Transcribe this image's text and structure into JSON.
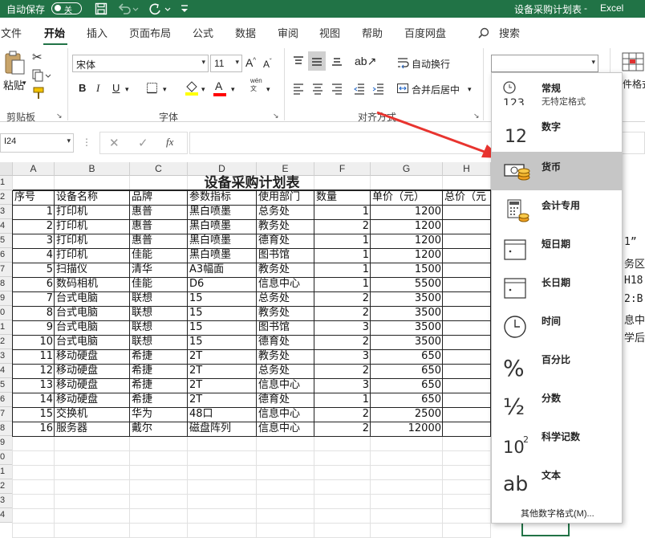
{
  "titlebar": {
    "autosave": "自动保存",
    "toggle": "关",
    "doc_title": "设备采购计划表",
    "app": "Excel"
  },
  "tabs": [
    "文件",
    "开始",
    "插入",
    "页面布局",
    "公式",
    "数据",
    "审阅",
    "视图",
    "帮助",
    "百度网盘"
  ],
  "search": "搜索",
  "ribbon": {
    "paste": "粘贴",
    "clipboard": "剪贴板",
    "font_name": "宋体",
    "font_size": "11",
    "font_group": "字体",
    "wrap": "自动换行",
    "merge": "合并后居中",
    "align_group": "对齐方式",
    "style_btn": "件格式"
  },
  "formula_bar": {
    "name_box": "I24",
    "fx": "fx"
  },
  "grid": {
    "columns": [
      "A",
      "B",
      "C",
      "D",
      "E",
      "F",
      "G",
      "H"
    ],
    "row_numbers": [
      "1",
      "2",
      "3",
      "4",
      "5",
      "6",
      "7",
      "8",
      "9",
      "0",
      "1",
      "2",
      "3",
      "4",
      "5",
      "6",
      "7",
      "8",
      "9",
      "0",
      "1",
      "2",
      "3",
      "4"
    ],
    "title": "设备采购计划表",
    "headers": [
      "序号",
      "设备名称",
      "品牌",
      "参数指标",
      "使用部门",
      "数量",
      "单价（元）",
      "总价（元"
    ],
    "rows": [
      [
        "1",
        "打印机",
        "惠普",
        "黑白喷墨",
        "总务处",
        "1",
        "1200"
      ],
      [
        "2",
        "打印机",
        "惠普",
        "黑白喷墨",
        "教务处",
        "2",
        "1200"
      ],
      [
        "3",
        "打印机",
        "惠普",
        "黑白喷墨",
        "德育处",
        "1",
        "1200"
      ],
      [
        "4",
        "打印机",
        "佳能",
        "黑白喷墨",
        "图书馆",
        "1",
        "1200"
      ],
      [
        "5",
        "扫描仪",
        "清华",
        "A3幅面",
        "教务处",
        "1",
        "1500"
      ],
      [
        "6",
        "数码相机",
        "佳能",
        "D6",
        "信息中心",
        "1",
        "5500"
      ],
      [
        "7",
        "台式电脑",
        "联想",
        "15",
        "总务处",
        "2",
        "3500"
      ],
      [
        "8",
        "台式电脑",
        "联想",
        "15",
        "教务处",
        "2",
        "3500"
      ],
      [
        "9",
        "台式电脑",
        "联想",
        "15",
        "图书馆",
        "3",
        "3500"
      ],
      [
        "10",
        "台式电脑",
        "联想",
        "15",
        "德育处",
        "2",
        "3500"
      ],
      [
        "11",
        "移动硬盘",
        "希捷",
        "2T",
        "教务处",
        "3",
        "650"
      ],
      [
        "12",
        "移动硬盘",
        "希捷",
        "2T",
        "总务处",
        "2",
        "650"
      ],
      [
        "13",
        "移动硬盘",
        "希捷",
        "2T",
        "信息中心",
        "3",
        "650"
      ],
      [
        "14",
        "移动硬盘",
        "希捷",
        "2T",
        "德育处",
        "1",
        "650"
      ],
      [
        "15",
        "交换机",
        "华为",
        "48口",
        "信息中心",
        "2",
        "2500"
      ],
      [
        "16",
        "服务器",
        "戴尔",
        "磁盘阵列",
        "信息中心",
        "2",
        "12000"
      ]
    ]
  },
  "side_text": [
    "1”",
    "务区:",
    "H18",
    "2:B",
    "息中/",
    "学后"
  ],
  "number_format": {
    "items": [
      {
        "label": "常规",
        "sub": "无特定格式",
        "icon": "123"
      },
      {
        "label": "数字",
        "sub": "",
        "icon": "12"
      },
      {
        "label": "货币",
        "sub": "",
        "icon": "currency-icon"
      },
      {
        "label": "会计专用",
        "sub": "",
        "icon": "accounting-icon"
      },
      {
        "label": "短日期",
        "sub": "",
        "icon": "calendar-icon"
      },
      {
        "label": "长日期",
        "sub": "",
        "icon": "calendar-icon"
      },
      {
        "label": "时间",
        "sub": "",
        "icon": "clock-icon"
      },
      {
        "label": "百分比",
        "sub": "",
        "icon": "%"
      },
      {
        "label": "分数",
        "sub": "",
        "icon": "½"
      },
      {
        "label": "科学记数",
        "sub": "",
        "icon": "10²"
      },
      {
        "label": "文本",
        "sub": "",
        "icon": "ab"
      }
    ],
    "more": "其他数字格式(M)..."
  },
  "colors": {
    "excel_green": "#217346",
    "arrow": "#e8342f",
    "highlight": "#c6c6c6"
  }
}
